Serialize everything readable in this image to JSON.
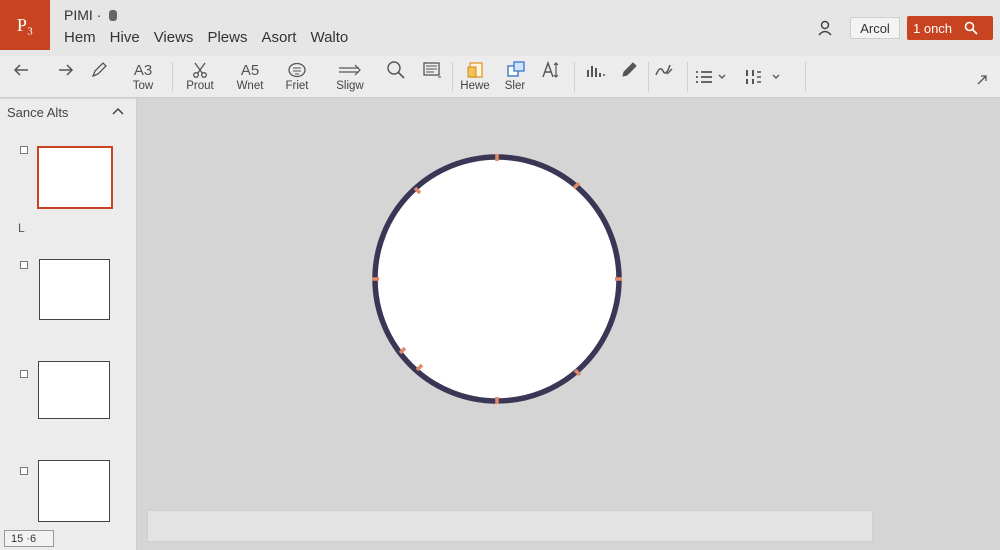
{
  "app": {
    "logo": "P₃",
    "title": "PIMI ·",
    "accent": "#c8431f"
  },
  "menu": [
    "Hem",
    "Hive",
    "Views",
    "Plews",
    "Asort",
    "Walto"
  ],
  "header": {
    "user_icon": "user-icon",
    "cancel_label": "Arcol",
    "search_label": "1 onch",
    "search_icon": "search-icon"
  },
  "ribbon": {
    "undo_icon": "undo-icon",
    "redo_icon": "redo-icon",
    "pen_icon": "pen-icon",
    "tow_glyph": "A3",
    "tow_label": "Tow",
    "prout_label": "Prout",
    "wnet_glyph": "A5",
    "wnet_label": "Wnet",
    "friet_label": "Friet",
    "sligw_label": "Sligw",
    "hewe_label": "Hewe",
    "sler_label": "Sler"
  },
  "slides_panel": {
    "title": "Sance Alts",
    "section_marker": "L"
  },
  "status": {
    "slide_counter": "15 ·6"
  },
  "colors": {
    "circle_stroke": "#3b3556",
    "circle_ticks": "#e08a6a",
    "canvas_bg": "#d5d5d5"
  }
}
